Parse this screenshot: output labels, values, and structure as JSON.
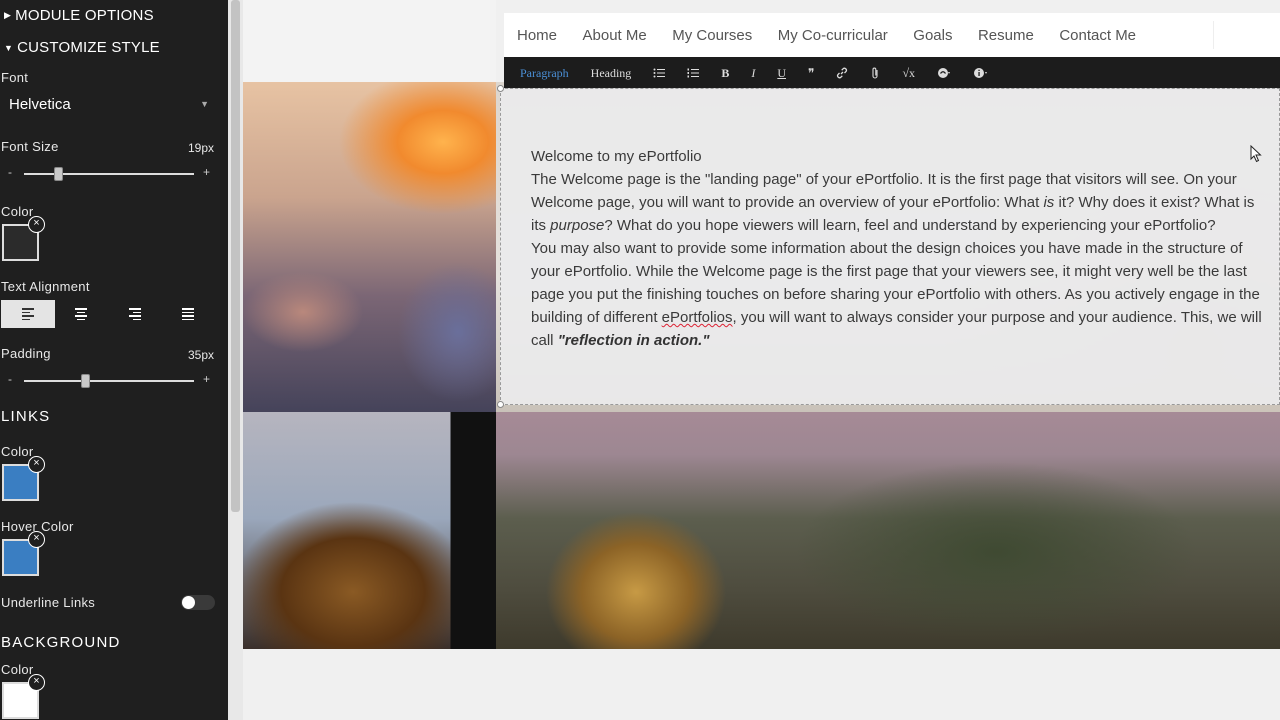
{
  "sidebar": {
    "module_options": "MODULE OPTIONS",
    "customize_style": "CUSTOMIZE STYLE",
    "font_label": "Font",
    "font_value": "Helvetica",
    "font_size_label": "Font Size",
    "font_size_value": "19px",
    "font_size_level": 0.2,
    "color_label": "Color",
    "text_color": "#2b2b2b",
    "text_alignment_label": "Text Alignment",
    "text_alignment_selected": "left",
    "padding_label": "Padding",
    "padding_value": "35px",
    "padding_level": 0.36,
    "links_heading": "LINKS",
    "links_color_label": "Color",
    "links_color": "#3a7ec2",
    "hover_color_label": "Hover Color",
    "hover_color": "#3a7ec2",
    "underline_links_label": "Underline Links",
    "underline_links_on": false,
    "background_heading": "BACKGROUND",
    "background_color_label": "Color",
    "background_color": "#ffffff",
    "slider_minus": "-",
    "slider_plus": "+",
    "remove_glyph": "×"
  },
  "nav": {
    "items": [
      "Home",
      "About Me",
      "My Courses",
      "My Co-curricular",
      "Goals",
      "Resume",
      "Contact Me"
    ]
  },
  "toolbar": {
    "paragraph": "Paragraph",
    "heading": "Heading",
    "bullet_list_icon": "bulleted-list-icon",
    "numbered_list_icon": "numbered-list-icon",
    "bold": "B",
    "italic": "I",
    "underline": "U",
    "quote": "❞",
    "link_icon": "link-icon",
    "attach_icon": "paperclip-icon",
    "math": "√x",
    "special_char_icon": "special-character-icon",
    "info_icon": "info-icon"
  },
  "content": {
    "p1": "Welcome to my ePortfolio",
    "p2": "The Welcome page is the \"landing page\" of your ePortfolio. It is the first page that visitors will see. On your Welcome page, you will want to provide an overview of your ePortfolio: What ",
    "p2_em1": "is",
    "p2_b": " it? Why does it exist?  What is its ",
    "p2_em2": "purpose",
    "p2_c": "? What do you hope viewers will learn, feel and understand by experiencing your ePortfolio?",
    "p3": "You may also want to provide some information about the design choices you have made in the structure of your ePortfolio. While the Welcome page is the first page that your viewers see, it might very well be the last page you put the finishing touches on before sharing your ePortfolio with others. As you actively engage in the building of different ",
    "p3_spell": "ePortfolios",
    "p3_b": ", you will want to always consider your purpose and your audience. This, we will call ",
    "p3_strong": "\"reflection in action.\""
  }
}
